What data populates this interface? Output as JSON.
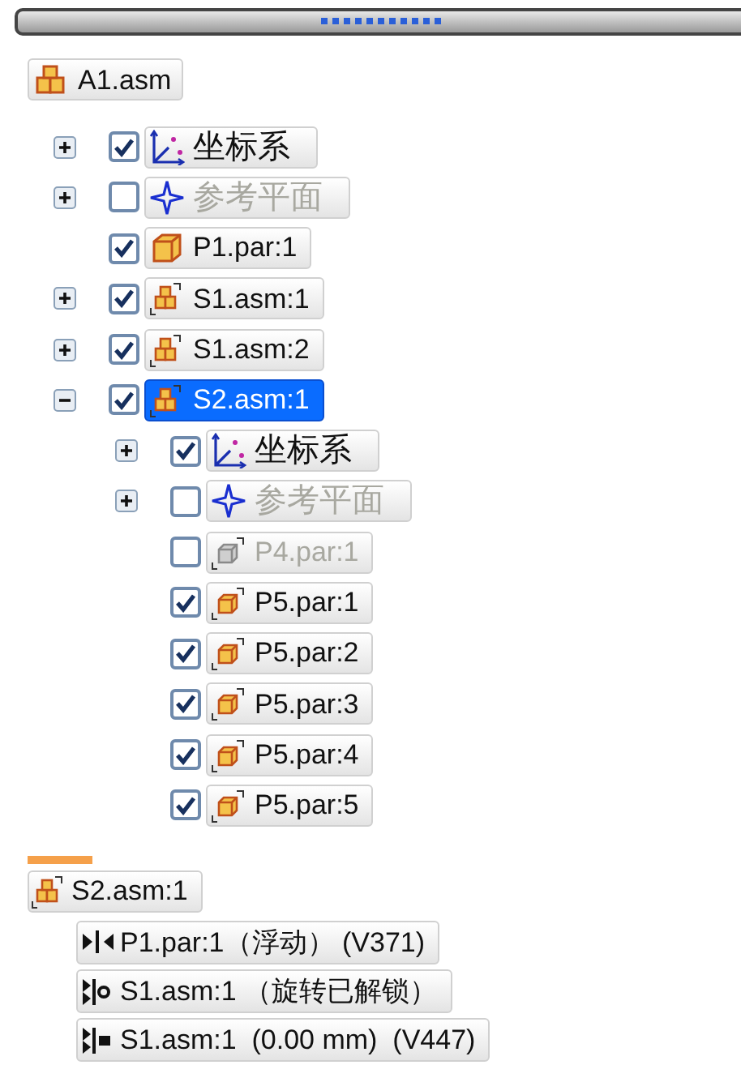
{
  "tree": {
    "label": "A1.asm",
    "kind": "asm",
    "selected": false,
    "children": [
      {
        "label": "坐标系",
        "kind": "coords",
        "expanded": false,
        "checked": true,
        "disabled": false,
        "selected": false
      },
      {
        "label": "参考平面",
        "kind": "plane",
        "expanded": false,
        "checked": false,
        "disabled": true,
        "selected": false
      },
      {
        "label": "P1.par:1",
        "kind": "part",
        "checked": true,
        "disabled": false,
        "selected": false
      },
      {
        "label": "S1.asm:1",
        "kind": "subasm",
        "expanded": false,
        "checked": true,
        "disabled": false,
        "selected": false
      },
      {
        "label": "S1.asm:2",
        "kind": "subasm",
        "expanded": false,
        "checked": true,
        "disabled": false,
        "selected": false
      },
      {
        "label": "S2.asm:1",
        "kind": "subasm",
        "expanded": true,
        "checked": true,
        "disabled": false,
        "selected": true,
        "children": [
          {
            "label": "坐标系",
            "kind": "coords",
            "expanded": false,
            "checked": true,
            "disabled": false,
            "selected": false
          },
          {
            "label": "参考平面",
            "kind": "plane",
            "expanded": false,
            "checked": false,
            "disabled": true,
            "selected": false
          },
          {
            "label": "P4.par:1",
            "kind": "subpart",
            "checked": false,
            "disabled": true,
            "selected": false
          },
          {
            "label": "P5.par:1",
            "kind": "subpart",
            "checked": true,
            "disabled": false,
            "selected": false
          },
          {
            "label": "P5.par:2",
            "kind": "subpart",
            "checked": true,
            "disabled": false,
            "selected": false
          },
          {
            "label": "P5.par:3",
            "kind": "subpart",
            "checked": true,
            "disabled": false,
            "selected": false
          },
          {
            "label": "P5.par:4",
            "kind": "subpart",
            "checked": true,
            "disabled": false,
            "selected": false
          },
          {
            "label": "P5.par:5",
            "kind": "subpart",
            "checked": true,
            "disabled": false,
            "selected": false
          }
        ]
      }
    ]
  },
  "relations_panel": {
    "owner": {
      "label": "S2.asm:1",
      "kind": "subasm"
    },
    "relations": [
      {
        "kind": "mate",
        "text": "P1.par:1（浮动） (V371)"
      },
      {
        "kind": "axial",
        "text": "S1.asm:1 （旋转已解锁）"
      },
      {
        "kind": "planar",
        "text": "S1.asm:1  (0.00 mm)  (V447)"
      }
    ]
  }
}
